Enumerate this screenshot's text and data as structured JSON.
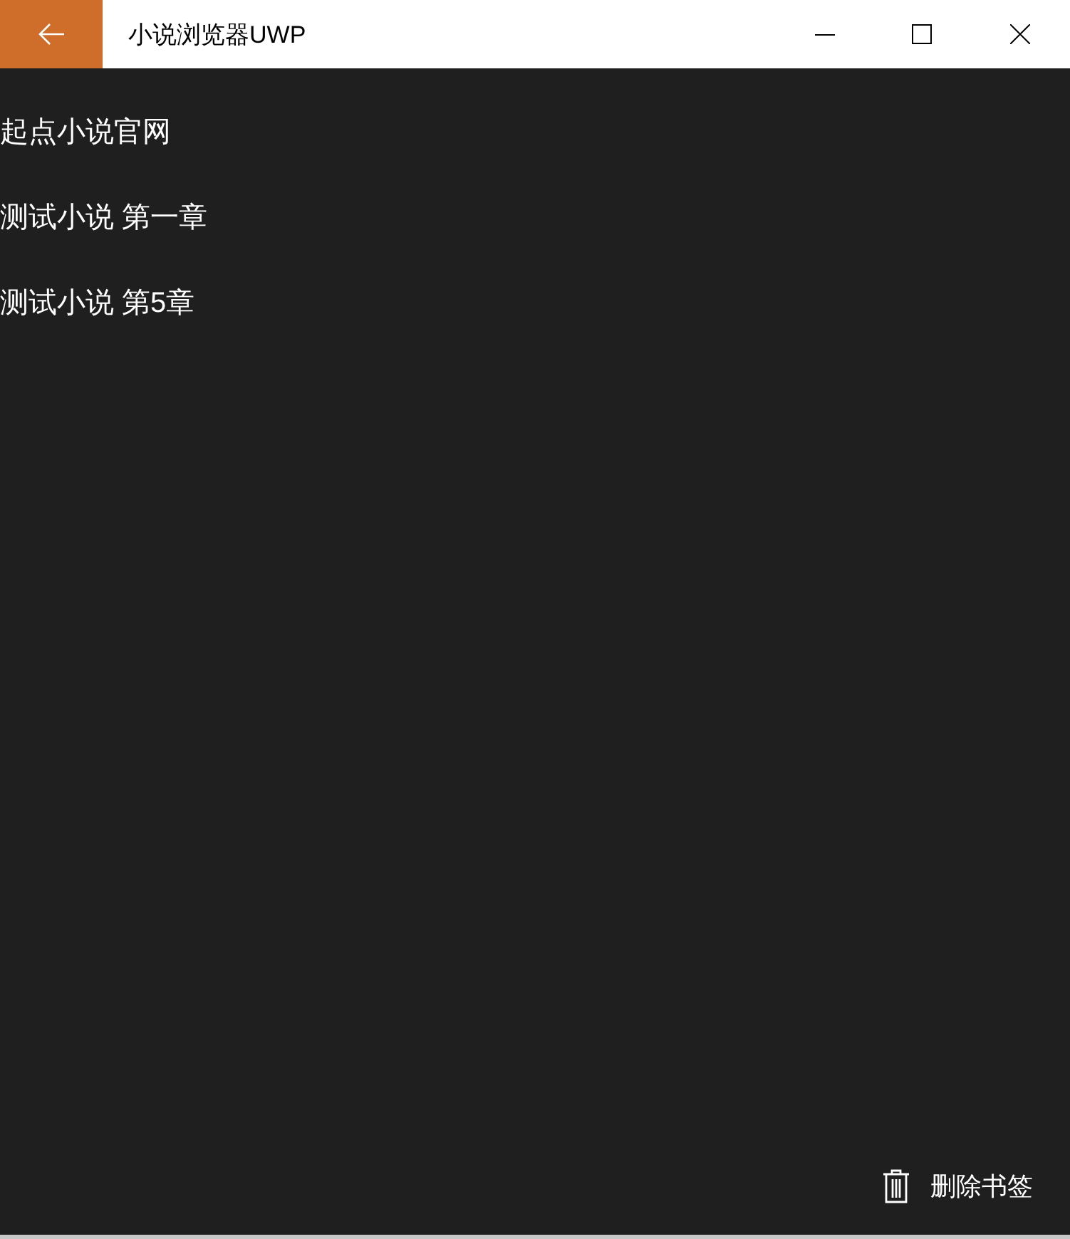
{
  "window": {
    "title": "小说浏览器UWP"
  },
  "bookmarks": [
    {
      "label": "起点小说官网"
    },
    {
      "label": "测试小说 第一章"
    },
    {
      "label": "测试小说 第5章"
    }
  ],
  "command_bar": {
    "buttons": [
      {
        "kind": "delete",
        "label": "删除书签"
      }
    ]
  }
}
